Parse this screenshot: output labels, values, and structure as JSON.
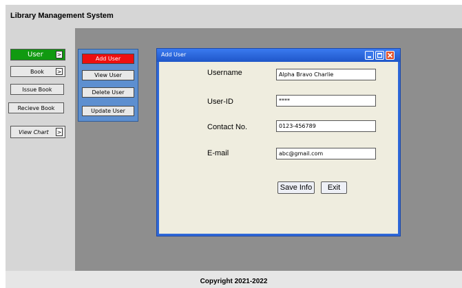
{
  "app": {
    "title": "Library Management System"
  },
  "sidebar": {
    "items": [
      {
        "label": "User",
        "arrow": ">"
      },
      {
        "label": "Book",
        "arrow": ">"
      },
      {
        "label": "Issue Book"
      },
      {
        "label": "Recieve Book"
      },
      {
        "label": "View Chart",
        "arrow": ">"
      }
    ]
  },
  "submenu": {
    "items": [
      "Add User",
      "View User",
      "Delete User",
      "Update User"
    ]
  },
  "dialog": {
    "title": "Add User",
    "fields": [
      {
        "label": "Username",
        "value": "Alpha Bravo Charlie"
      },
      {
        "label": "User-ID",
        "value": "****"
      },
      {
        "label": "Contact No.",
        "value": "0123-456789"
      },
      {
        "label": "E-mail",
        "value": "abc@gmail.com"
      }
    ],
    "save_label": "Save Info",
    "exit_label": "Exit"
  },
  "footer": {
    "copyright": "Copyright 2021-2022"
  },
  "colors": {
    "active_nav": "#119a11",
    "active_submenu": "#ee0f0f",
    "dialog_frame": "#2f68d8"
  }
}
